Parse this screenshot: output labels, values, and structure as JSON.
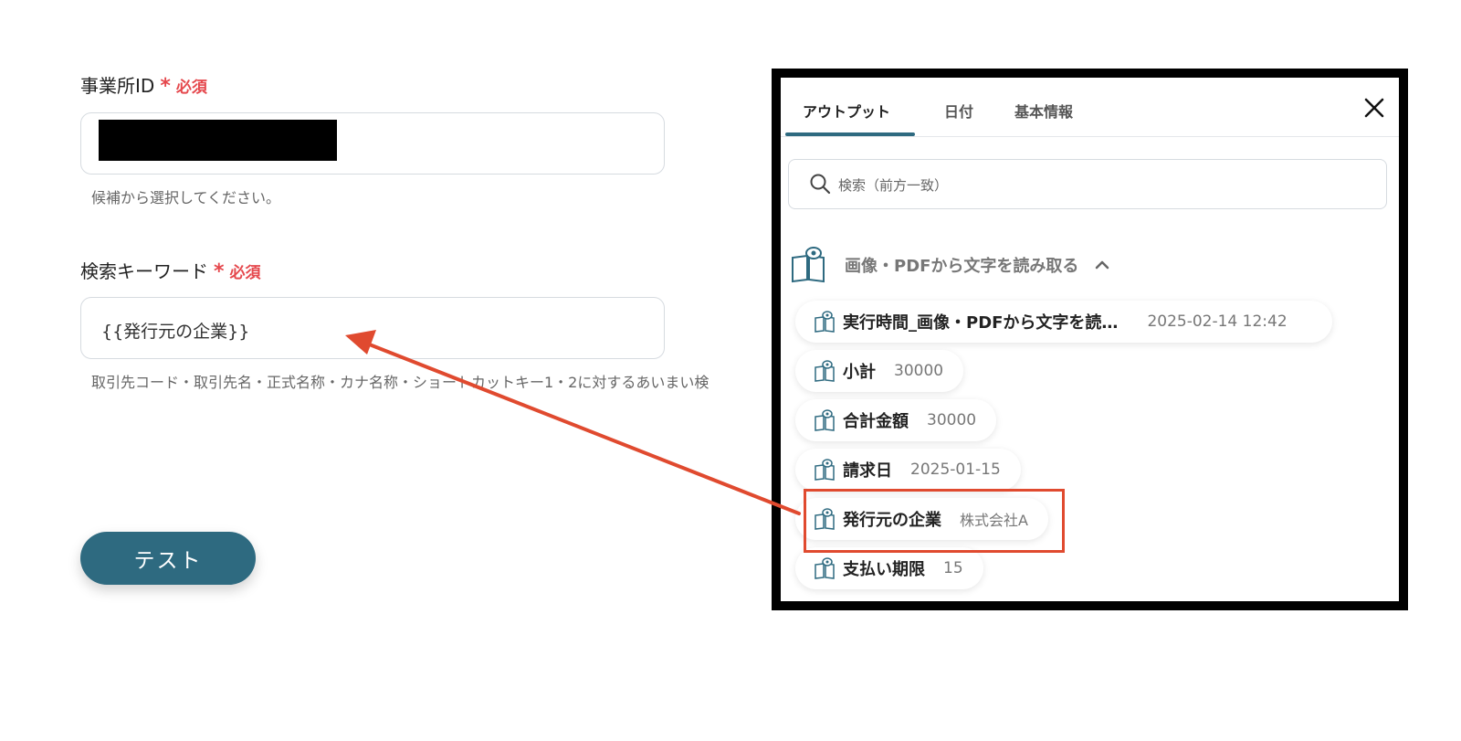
{
  "form": {
    "office_label": "事業所ID",
    "required_star": "*",
    "required_text": "必須",
    "office_help": "候補から選択してください。",
    "keyword_label": "検索キーワード",
    "keyword_value": "{{発行元の企業}}",
    "keyword_help": "取引先コード・取引先名・正式名称・カナ名称・ショートカットキー1・2に対するあいまい検",
    "test_button": "テスト"
  },
  "panel": {
    "tabs": [
      {
        "label": "アウトプット",
        "active": true
      },
      {
        "label": "日付",
        "active": false
      },
      {
        "label": "基本情報",
        "active": false
      }
    ],
    "search_placeholder": "検索（前方一致）",
    "section_label": "画像・PDFから文字を読み取る",
    "items": [
      {
        "name": "実行時間_画像・PDFから文字を読…",
        "value": "2025-02-14 12:42"
      },
      {
        "name": "小計",
        "value": "30000"
      },
      {
        "name": "合計金額",
        "value": "30000"
      },
      {
        "name": "請求日",
        "value": "2025-01-15"
      },
      {
        "name": "発行元の企業",
        "value": "株式会社A"
      },
      {
        "name": "支払い期限",
        "value": "15"
      }
    ]
  },
  "colors": {
    "accent": "#2e6a80",
    "required": "#e5484d",
    "highlight": "#e04a2f"
  }
}
